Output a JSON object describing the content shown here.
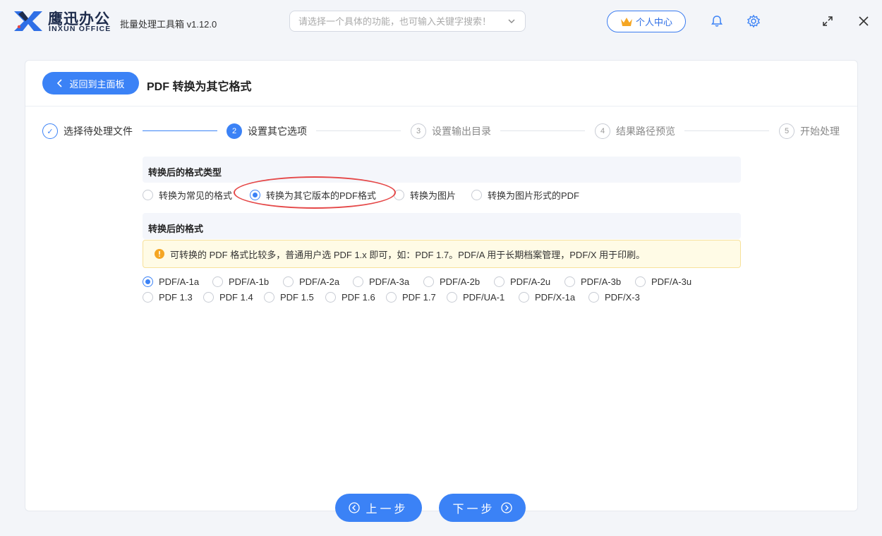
{
  "titlebar": {
    "brand_cn": "鹰迅办公",
    "brand_en": "INXUN OFFICE",
    "app_title": "批量处理工具箱 v1.12.0",
    "search_placeholder": "请选择一个具体的功能，也可输入关键字搜索！",
    "user_center": "个人中心"
  },
  "header": {
    "back_label": "返回到主面板",
    "page_title": "PDF 转换为其它格式"
  },
  "steps": [
    {
      "num": "✓",
      "label": "选择待处理文件",
      "state": "done"
    },
    {
      "num": "2",
      "label": "设置其它选项",
      "state": "active"
    },
    {
      "num": "3",
      "label": "设置输出目录",
      "state": "todo"
    },
    {
      "num": "4",
      "label": "结果路径预览",
      "state": "todo"
    },
    {
      "num": "5",
      "label": "开始处理",
      "state": "todo"
    }
  ],
  "format_type": {
    "heading": "转换后的格式类型",
    "options": [
      {
        "label": "转换为常见的格式",
        "selected": false
      },
      {
        "label": "转换为其它版本的PDF格式",
        "selected": true
      },
      {
        "label": "转换为图片",
        "selected": false
      },
      {
        "label": "转换为图片形式的PDF",
        "selected": false
      }
    ]
  },
  "format": {
    "heading": "转换后的格式",
    "notice": "可转换的 PDF 格式比较多，普通用户选 PDF 1.x 即可，如：PDF 1.7。PDF/A 用于长期档案管理，PDF/X 用于印刷。",
    "row1": [
      {
        "label": "PDF/A-1a",
        "selected": true
      },
      {
        "label": "PDF/A-1b",
        "selected": false
      },
      {
        "label": "PDF/A-2a",
        "selected": false
      },
      {
        "label": "PDF/A-3a",
        "selected": false
      },
      {
        "label": "PDF/A-2b",
        "selected": false
      },
      {
        "label": "PDF/A-2u",
        "selected": false
      },
      {
        "label": "PDF/A-3b",
        "selected": false
      },
      {
        "label": "PDF/A-3u",
        "selected": false
      }
    ],
    "row2": [
      {
        "label": "PDF 1.3",
        "selected": false
      },
      {
        "label": "PDF 1.4",
        "selected": false
      },
      {
        "label": "PDF 1.5",
        "selected": false
      },
      {
        "label": "PDF 1.6",
        "selected": false
      },
      {
        "label": "PDF 1.7",
        "selected": false
      },
      {
        "label": "PDF/UA-1",
        "selected": false
      },
      {
        "label": "PDF/X-1a",
        "selected": false
      },
      {
        "label": "PDF/X-3",
        "selected": false
      }
    ]
  },
  "footer": {
    "prev_label": "上一步",
    "next_label": "下一步"
  },
  "colors": {
    "accent": "#3b82f6",
    "annotation": "#e54848",
    "notice_bg": "#fffbe6"
  }
}
